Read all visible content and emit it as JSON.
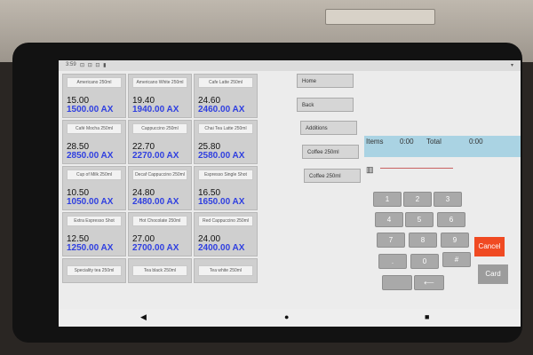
{
  "statusbar": {
    "time": "3:59",
    "status_icons": "⊡ ⊡ ⊡ ▮",
    "wifi_icon": "wifi-icon"
  },
  "products": [
    {
      "name": "Americano 250ml",
      "price": "15.00",
      "price_ax": "1500.00 AX"
    },
    {
      "name": "Americano White 250ml",
      "price": "19.40",
      "price_ax": "1940.00 AX"
    },
    {
      "name": "Cafe Latte 250ml",
      "price": "24.60",
      "price_ax": "2460.00 AX"
    },
    {
      "name": "Café Mocha 250ml",
      "price": "28.50",
      "price_ax": "2850.00 AX"
    },
    {
      "name": "Cappuccino 250ml",
      "price": "22.70",
      "price_ax": "2270.00 AX"
    },
    {
      "name": "Chai Tea Latte 250ml",
      "price": "25.80",
      "price_ax": "2580.00 AX"
    },
    {
      "name": "Cup of Milk 250ml",
      "price": "10.50",
      "price_ax": "1050.00 AX"
    },
    {
      "name": "Decaf Cappuccino 250ml",
      "price": "24.80",
      "price_ax": "2480.00 AX"
    },
    {
      "name": "Espresso Single Shot",
      "price": "16.50",
      "price_ax": "1650.00 AX"
    },
    {
      "name": "Extra Espresso Shot",
      "price": "12.50",
      "price_ax": "1250.00 AX"
    },
    {
      "name": "Hot Chocolate 250ml",
      "price": "27.00",
      "price_ax": "2700.00 AX"
    },
    {
      "name": "Red Cappuccino 250ml",
      "price": "24.00",
      "price_ax": "2400.00 AX"
    },
    {
      "name": "Speciality tea 250ml",
      "price": "",
      "price_ax": ""
    },
    {
      "name": "Tea black 250ml",
      "price": "",
      "price_ax": ""
    },
    {
      "name": "Tea white 250ml",
      "price": "",
      "price_ax": ""
    }
  ],
  "side_buttons": {
    "home": "Home",
    "back": "Back",
    "additions": "Additions",
    "coffee_1": "Coffee 250ml",
    "coffee_2": "Coffee 250ml"
  },
  "order": {
    "items_label": "Items",
    "items_value": "0:00",
    "total_label": "Total",
    "total_value": "0:00",
    "barcode_icon": "barcode-icon"
  },
  "keypad": {
    "k1": "1",
    "k2": "2",
    "k3": "3",
    "k4": "4",
    "k5": "5",
    "k6": "6",
    "k7": "7",
    "k8": "8",
    "k9": "9",
    "dot": ".",
    "k0": "0",
    "hash": "#",
    "backspace": "⟵",
    "cancel": "Cancel",
    "card": "Card"
  },
  "navbar": {
    "back": "◀",
    "home": "●",
    "recents": "■"
  },
  "colors": {
    "accent": "#2f3fe0",
    "cancel": "#f04a22",
    "order_header": "#aad3e3"
  }
}
